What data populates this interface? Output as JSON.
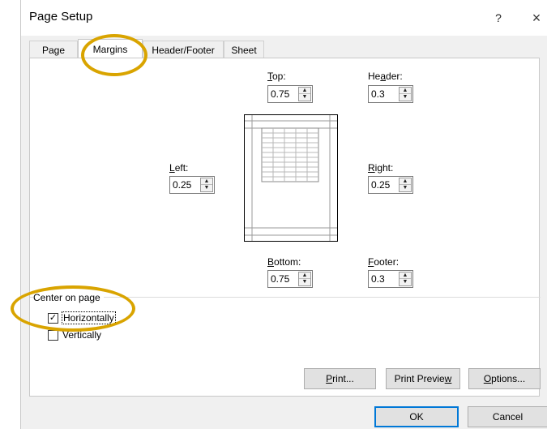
{
  "dialog": {
    "title": "Page Setup",
    "help": "?",
    "close": "×"
  },
  "tabs": [
    {
      "label": "Page"
    },
    {
      "label": "Margins"
    },
    {
      "label": "Header/Footer"
    },
    {
      "label": "Sheet"
    }
  ],
  "margins": {
    "top": {
      "label_u": "T",
      "label_rest": "op:",
      "value": "0.75"
    },
    "header": {
      "label_a": "He",
      "label_u": "a",
      "label_rest": "der:",
      "value": "0.3"
    },
    "left": {
      "label_u": "L",
      "label_rest": "eft:",
      "value": "0.25"
    },
    "right": {
      "label_u": "R",
      "label_rest": "ight:",
      "value": "0.25"
    },
    "bottom": {
      "label_u": "B",
      "label_rest": "ottom:",
      "value": "0.75"
    },
    "footer": {
      "label_u": "F",
      "label_rest": "ooter:",
      "value": "0.3"
    }
  },
  "center_on_page": {
    "title": "Center on page",
    "horizontally": {
      "label": "Horizontally",
      "checked": true
    },
    "vertically": {
      "label": "Vertically",
      "checked": false
    }
  },
  "buttons": {
    "print": {
      "u": "P",
      "rest": "rint..."
    },
    "print_preview": {
      "pre": "Print Previe",
      "u": "w"
    },
    "options": {
      "u": "O",
      "rest": "ptions..."
    },
    "ok": "OK",
    "cancel": "Cancel"
  },
  "colors": {
    "highlight_circle": "#d9a400",
    "accent": "#0078d7"
  }
}
